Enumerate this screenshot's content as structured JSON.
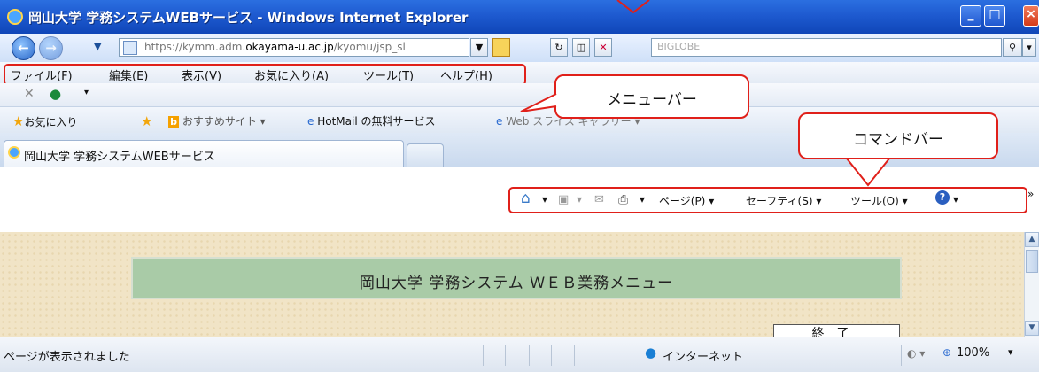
{
  "window": {
    "title": "岡山大学 学務システムWEBサービス - Windows Internet Explorer"
  },
  "address": {
    "url_prefix": "https://kymm.adm.",
    "url_domain": "okayama-u.ac.jp",
    "url_path": "/kyomu/jsp_sl"
  },
  "search": {
    "provider": "BIGLOBE"
  },
  "menu": [
    "ファイル(F)",
    "編集(E)",
    "表示(V)",
    "お気に入り(A)",
    "ツール(T)",
    "ヘルプ(H)"
  ],
  "favorites": {
    "label": "お気に入り",
    "items": [
      "おすすめサイト ▾",
      "HotMail の無料サービス",
      "Web スライス ギャラリー ▾"
    ]
  },
  "tab": {
    "title": "岡山大学 学務システムWEBサービス"
  },
  "command_bar": {
    "page": "ページ(P)",
    "safety": "セーフティ(S)",
    "tools": "ツール(O)"
  },
  "callouts": {
    "menubar": "メニューバー",
    "commandbar": "コマンドバー"
  },
  "content": {
    "banner": "岡山大学 学務システム ＷＥＢ業務メニュー",
    "exit_button": "終了"
  },
  "status": {
    "text": "ページが表示されました",
    "zone": "インターネット",
    "zoom": "100%"
  },
  "colors": {
    "highlight": "#e0201a",
    "banner": "#a9cba7",
    "titlebar": "#1e5ad0"
  },
  "icons": [
    "ie-icon",
    "back-icon",
    "forward-icon",
    "lock-icon",
    "refresh-icon",
    "stop-icon",
    "search-icon",
    "close-icon",
    "star-icon",
    "home-icon",
    "rss-icon",
    "mail-icon",
    "print-icon",
    "help-icon",
    "globe-icon"
  ]
}
